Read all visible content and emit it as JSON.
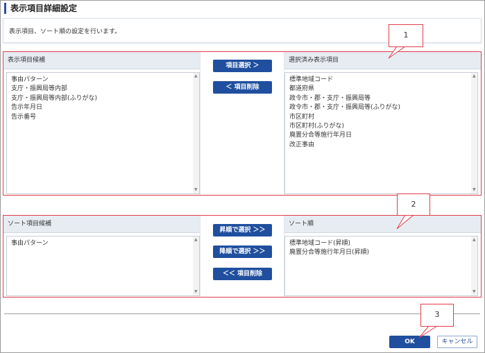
{
  "page": {
    "title": "表示項目詳細設定",
    "description": "表示項目、ソート順の設定を行います。"
  },
  "display": {
    "candidates_header": "表示項目候補",
    "candidates": [
      "事由パターン",
      "支庁・振興局等内部",
      "支庁・振興局等内部(ふりがな)",
      "告示年月日",
      "告示番号"
    ],
    "select_button": "項目選択 ＞",
    "remove_button": "＜ 項目削除",
    "selected_header": "選択済み表示項目",
    "selected": [
      "標準地域コード",
      "都道府県",
      "政令市・郡・支庁・振興局等",
      "政令市・郡・支庁・振興局等(ふりがな)",
      "市区町村",
      "市区町村(ふりがな)",
      "廃置分合等施行年月日",
      "改正事由"
    ]
  },
  "sort": {
    "candidates_header": "ソート項目候補",
    "candidates": [
      "事由パターン"
    ],
    "asc_button": "昇順で選択 ＞＞",
    "desc_button": "降順で選択 ＞＞",
    "remove_button": "＜＜ 項目削除",
    "order_header": "ソート順",
    "order": [
      "標準地域コード(昇順)",
      "廃置分合等施行年月日(昇順)"
    ]
  },
  "footer": {
    "ok_label": "OK",
    "cancel_label": "キャンセル"
  },
  "callouts": [
    "1",
    "2",
    "3"
  ],
  "colors": {
    "primary_button": "#1f4f9e",
    "highlight_border": "#e23b4a",
    "panel_header": "#e7ecf3"
  }
}
